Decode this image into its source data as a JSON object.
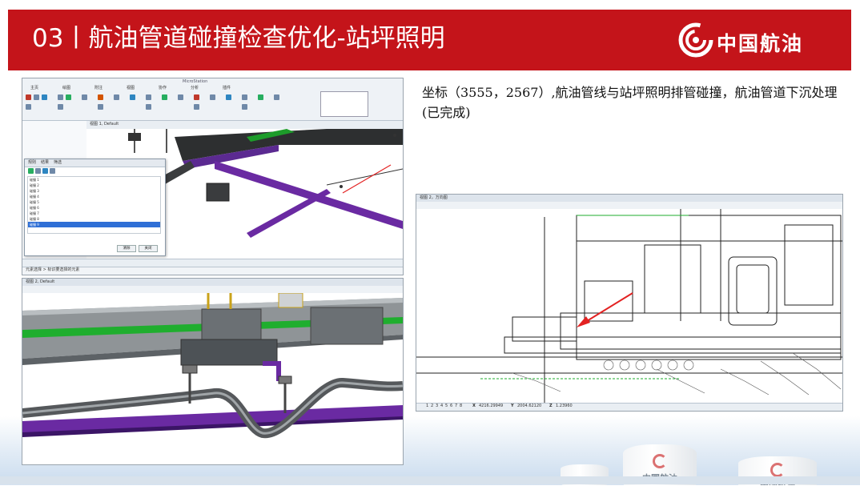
{
  "slide": {
    "title": "03丨航油管道碰撞检查优化-站坪照明",
    "logo_text": "中国航油",
    "caption": "坐标（3555，2567）,航油管线与站坪照明排管碰撞，航油管道下沉处理(已完成)",
    "tank_label": "中国航油"
  },
  "colors": {
    "header_red": "#c4141a",
    "pipe_purple": "#6a2aa2",
    "pipe_green": "#1fae2e",
    "clash_red": "#e32222"
  },
  "shot_top": {
    "window_title": "MicroStation",
    "ribbon_tabs": [
      "主页",
      "绘图",
      "附注",
      "视图",
      "协作",
      "分析",
      "插件"
    ],
    "view_title": "视图 1, Default",
    "panel": {
      "tabs": [
        "规则",
        "结果",
        "筛选"
      ],
      "rows": [
        "碰撞 1",
        "碰撞 2",
        "碰撞 3",
        "碰撞 4",
        "碰撞 5",
        "碰撞 6",
        "碰撞 7",
        "碰撞 8",
        "碰撞 9"
      ],
      "clear_label": "清除",
      "close_label": "关闭"
    },
    "status_text": "元素选择 > 标识要选择的元素"
  },
  "shot_bottom": {
    "view_title": "视图 2, Default"
  },
  "shot_plan": {
    "view_title": "视图 2，万向图",
    "view_numbers": [
      "1",
      "2",
      "3",
      "4",
      "5",
      "6",
      "7",
      "8"
    ],
    "coord_labels": [
      "X",
      "Y",
      "Z"
    ],
    "coord_values": [
      "4216.29949",
      "2004.62120",
      "1.23960"
    ]
  }
}
